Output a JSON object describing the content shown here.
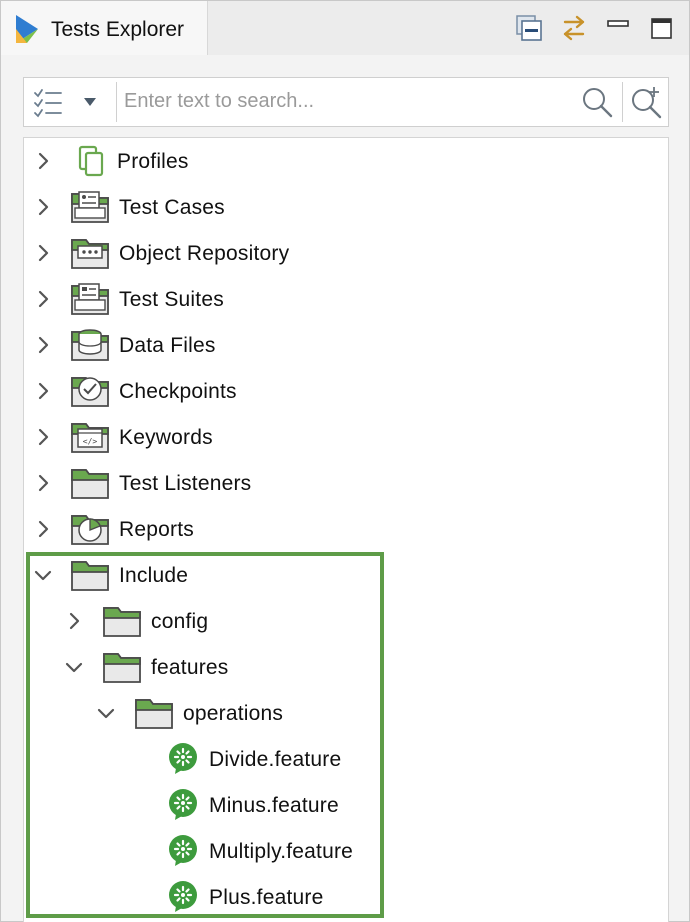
{
  "tab": {
    "title": "Tests Explorer"
  },
  "search": {
    "placeholder": "Enter text to search..."
  },
  "colors": {
    "accent_green": "#6aa84f",
    "highlight_border": "#5e9c48",
    "cucumber": "#3d9b3d"
  },
  "tree": [
    {
      "label": "Profiles",
      "expanded": false,
      "icon": "profiles-icon"
    },
    {
      "label": "Test Cases",
      "expanded": false,
      "icon": "test-cases-folder-icon"
    },
    {
      "label": "Object Repository",
      "expanded": false,
      "icon": "object-repository-folder-icon"
    },
    {
      "label": "Test Suites",
      "expanded": false,
      "icon": "test-suites-folder-icon"
    },
    {
      "label": "Data Files",
      "expanded": false,
      "icon": "data-files-folder-icon"
    },
    {
      "label": "Checkpoints",
      "expanded": false,
      "icon": "checkpoints-folder-icon"
    },
    {
      "label": "Keywords",
      "expanded": false,
      "icon": "keywords-folder-icon"
    },
    {
      "label": "Test Listeners",
      "expanded": false,
      "icon": "test-listeners-folder-icon"
    },
    {
      "label": "Reports",
      "expanded": false,
      "icon": "reports-folder-icon"
    },
    {
      "label": "Include",
      "expanded": true,
      "icon": "folder-icon"
    },
    {
      "label": "config",
      "expanded": false,
      "icon": "folder-icon"
    },
    {
      "label": "features",
      "expanded": true,
      "icon": "folder-icon"
    },
    {
      "label": "operations",
      "expanded": true,
      "icon": "folder-icon"
    },
    {
      "label": "Divide.feature",
      "icon": "cucumber-icon"
    },
    {
      "label": "Minus.feature",
      "icon": "cucumber-icon"
    },
    {
      "label": "Multiply.feature",
      "icon": "cucumber-icon"
    },
    {
      "label": "Plus.feature",
      "icon": "cucumber-icon"
    }
  ]
}
